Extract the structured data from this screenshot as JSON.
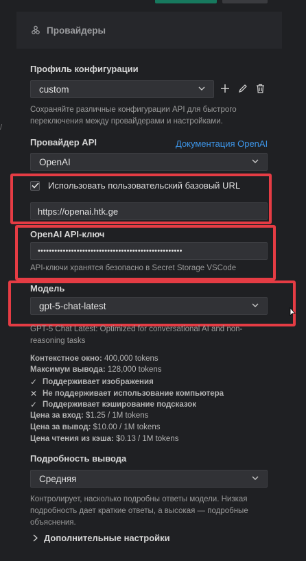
{
  "header": {
    "title": "Провайдеры",
    "icon": "webhook-icon"
  },
  "config_profile": {
    "label": "Профиль конфигурации",
    "selected": "custom",
    "description": "Сохраняйте различные конфигурации API для быстрого переключения между провайдерами и настройками."
  },
  "api_provider": {
    "label": "Провайдер API",
    "docs_link": "Документация OpenAI",
    "selected": "OpenAI"
  },
  "custom_base_url": {
    "checkbox_label": "Использовать пользовательский базовый URL",
    "checked": true,
    "value": "https://openai.htk.ge"
  },
  "api_key": {
    "label": "OpenAI API-ключ",
    "value": "••••••••••••••••••••••••••••••••••••••••••••••••••••",
    "description": "API-ключи хранятся безопасно в Secret Storage VSCode"
  },
  "model": {
    "label": "Модель",
    "selected": "gpt-5-chat-latest",
    "description": "GPT-5 Chat Latest: Optimized for conversational AI and non-reasoning tasks",
    "info": {
      "context_label": "Контекстное окно:",
      "context_value": "400,000 tokens",
      "max_output_label": "Максимум вывода:",
      "max_output_value": "128,000 tokens",
      "features": [
        {
          "icon": "check-icon",
          "text": "Поддерживает изображения"
        },
        {
          "icon": "x-icon",
          "text": "Не поддерживает использование компьютера"
        },
        {
          "icon": "check-icon",
          "text": "Поддерживает кэширование подсказок"
        }
      ],
      "input_price_label": "Цена за вход:",
      "input_price_value": "$1.25 / 1M tokens",
      "output_price_label": "Цена за вывод:",
      "output_price_value": "$10.00 / 1M tokens",
      "cache_price_label": "Цена чтения из кэша:",
      "cache_price_value": "$0.13 / 1M tokens"
    }
  },
  "verbosity": {
    "label": "Подробность вывода",
    "selected": "Средняя",
    "description": "Контролирует, насколько подробны ответы модели. Низкая подробность дает краткие ответы, а высокая — подробные объяснения."
  },
  "advanced": {
    "label": "Дополнительные настройки"
  },
  "colors": {
    "accent_red": "#e53c44",
    "link_blue": "#3d95e8",
    "bg": "#1f2023"
  }
}
